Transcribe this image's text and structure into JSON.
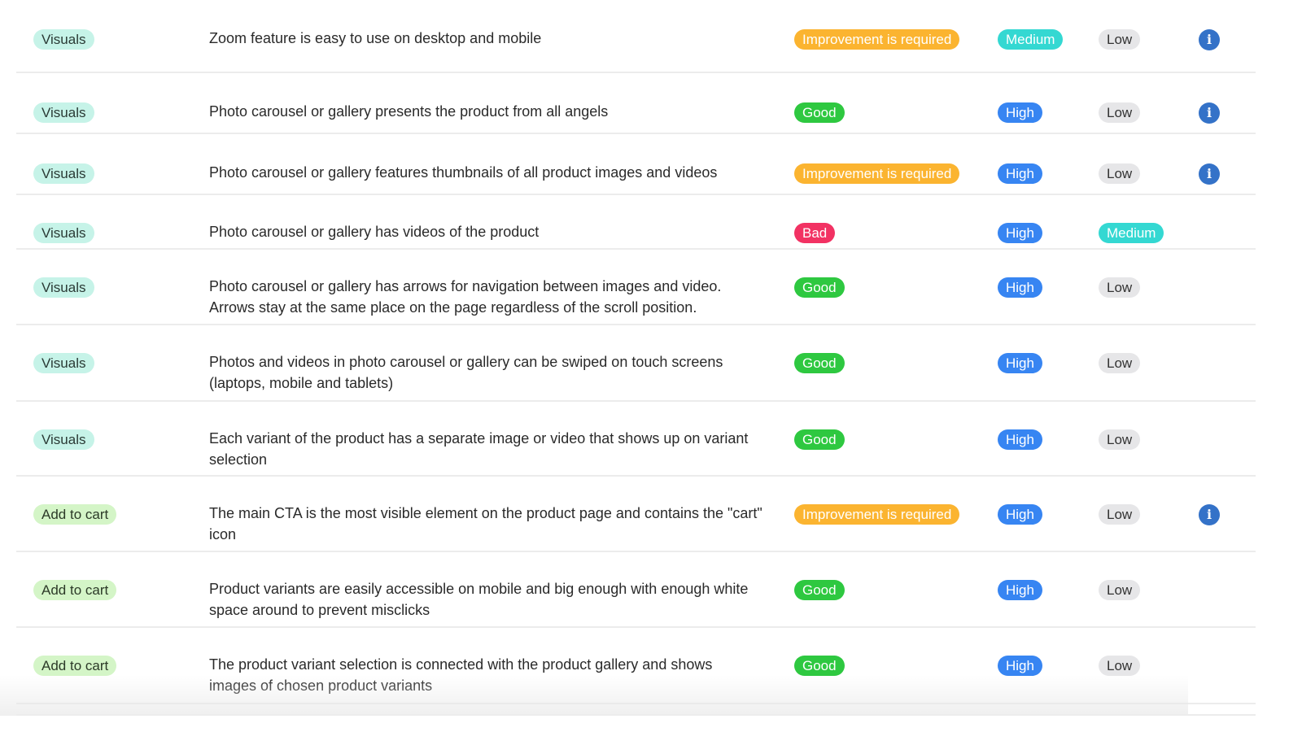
{
  "colors": {
    "good": "#2ec840",
    "improvement": "#fbb430",
    "bad": "#f23263",
    "high": "#3785f2",
    "medium": "#34d8d2",
    "low": "#e6e6e8",
    "info": "#3472c8"
  },
  "rows": [
    {
      "category": "Visuals",
      "description": "Zoom feature is easy to use on desktop and mobile",
      "status": "Improvement is required",
      "priority": "Medium",
      "effort": "Low",
      "info": true
    },
    {
      "category": "Visuals",
      "description": "Photo carousel or gallery presents the product from all angels",
      "status": "Good",
      "priority": "High",
      "effort": "Low",
      "info": true
    },
    {
      "category": "Visuals",
      "description": "Photo carousel or gallery features thumbnails of all product images and videos",
      "status": "Improvement is required",
      "priority": "High",
      "effort": "Low",
      "info": true
    },
    {
      "category": "Visuals",
      "description": "Photo carousel or gallery has videos of the product",
      "status": "Bad",
      "priority": "High",
      "effort": "Medium",
      "info": false
    },
    {
      "category": "Visuals",
      "description": "Photo carousel or gallery has arrows for navigation between images and video. Arrows stay at the same place on the page regardless of the scroll position.",
      "status": "Good",
      "priority": "High",
      "effort": "Low",
      "info": false
    },
    {
      "category": "Visuals",
      "description": "Photos and videos in photo carousel or gallery can be swiped on touch screens (laptops, mobile and tablets)",
      "status": "Good",
      "priority": "High",
      "effort": "Low",
      "info": false
    },
    {
      "category": "Visuals",
      "description": "Each variant of the product has a separate image or video that shows up on variant selection",
      "status": "Good",
      "priority": "High",
      "effort": "Low",
      "info": false
    },
    {
      "category": "Add to cart",
      "description": "The main CTA is the most visible element on the product page and contains the \"cart\" icon",
      "status": "Improvement is required",
      "priority": "High",
      "effort": "Low",
      "info": true
    },
    {
      "category": "Add to cart",
      "description": "Product variants are easily accessible on mobile and big enough with enough white space around to prevent misclicks",
      "status": "Good",
      "priority": "High",
      "effort": "Low",
      "info": false
    },
    {
      "category": "Add to cart",
      "description": "The product variant selection is connected with the product gallery and shows images of chosen product variants",
      "status": "Good",
      "priority": "High",
      "effort": "Low",
      "info": false
    }
  ],
  "info_icon": "i"
}
